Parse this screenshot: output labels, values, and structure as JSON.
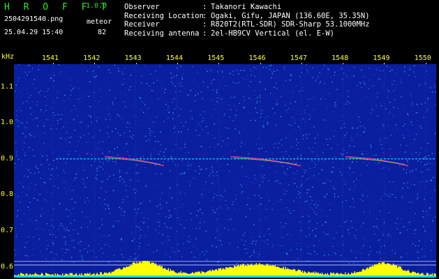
{
  "header": {
    "brand": "H R O F F T",
    "version": "1.0.0",
    "filename": "2504291540.png",
    "mode": "meteor",
    "datetime": "25.04.29 15:40",
    "count": "82",
    "info": [
      {
        "label": "Observer",
        "value": "Takanori Kawachi"
      },
      {
        "label": "Receiving Location",
        "value": "Ogaki, Gifu, JAPAN (136.60E, 35.35N)"
      },
      {
        "label": "Receiver",
        "value": "R820T2(RTL-SDR) SDR-Sharp 53.1000MHz"
      },
      {
        "label": "Receiving antenna",
        "value": "2el-HB9CV Vertical (el. E-W)"
      }
    ]
  },
  "axis": {
    "unit": "kHz",
    "time_ticks": [
      "1541",
      "1542",
      "1543",
      "1544",
      "1545",
      "1546",
      "1547",
      "1548",
      "1549",
      "1550"
    ],
    "freq_ticks": [
      "1.1",
      "1.0",
      "0.9",
      "0.8",
      "0.7",
      "0.6"
    ],
    "freq_values": [
      1.1,
      1.0,
      0.9,
      0.8,
      0.7,
      0.6
    ]
  },
  "colors": {
    "background": "#000000",
    "waterfall": "#0a1ea0",
    "brand": "#2ee82e",
    "axis": "#ffff33",
    "level": "#ffff00",
    "signal": "#00ffff"
  }
}
